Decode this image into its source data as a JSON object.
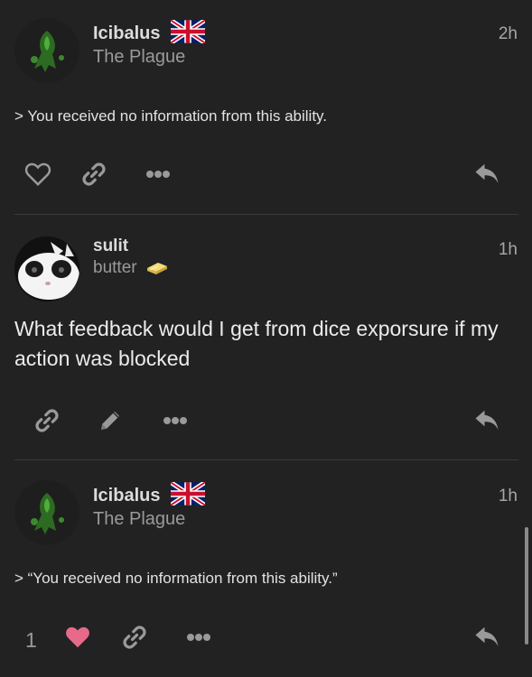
{
  "posts": [
    {
      "username": "Icibalus",
      "title": "The Plague",
      "time": "2h",
      "flag_icon": "uk-flag-icon",
      "content": "> You received no information from this ability."
    },
    {
      "username": "sulit",
      "title": "butter",
      "title_icon": "butter-icon",
      "time": "1h",
      "content": "What feedback would I get from dice exporsure if my action was blocked"
    },
    {
      "username": "Icibalus",
      "title": "The Plague",
      "time": "1h",
      "flag_icon": "uk-flag-icon",
      "content": "> “You received no information from this ability.”",
      "like_count": "1"
    }
  ],
  "colors": {
    "background": "#222222",
    "liked_heart": "#e86a8a",
    "icon_gray": "#9a9a9a"
  }
}
